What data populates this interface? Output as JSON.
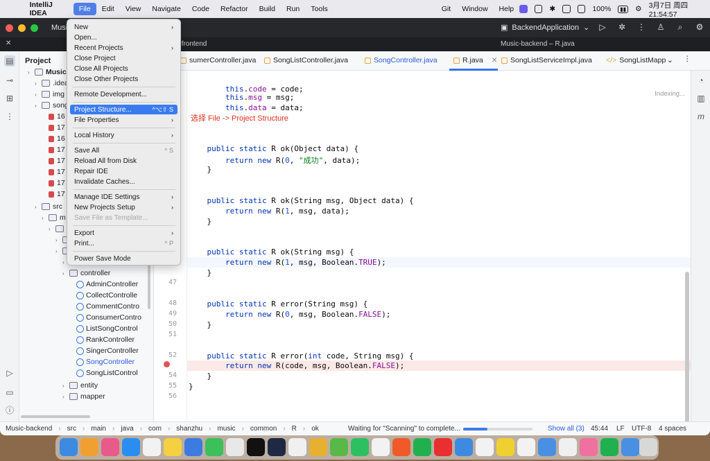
{
  "menubar": {
    "app_name": "IntelliJ IDEA",
    "items": [
      "File",
      "Edit",
      "View",
      "Navigate",
      "Code",
      "Refactor",
      "Build",
      "Run",
      "Tools"
    ],
    "right_items": [
      "Git",
      "Window",
      "Help"
    ],
    "battery": "100%",
    "datetime": "3月7日 周四  21:54:57"
  },
  "titlebar": {
    "project": "Music-b",
    "run_config": "BackendApplication",
    "frontend_tab": "r-frontend",
    "backend_title": "Music-backend – R.java"
  },
  "project_panel": {
    "header": "Project",
    "rows": [
      {
        "label": "Music-",
        "kind": "module"
      },
      {
        "label": ".idea",
        "kind": "folder"
      },
      {
        "label": "img",
        "kind": "folder"
      },
      {
        "label": "song",
        "kind": "folder"
      },
      {
        "label": "16",
        "kind": "res"
      },
      {
        "label": "17",
        "kind": "res"
      },
      {
        "label": "16",
        "kind": "res"
      },
      {
        "label": "17",
        "kind": "res"
      },
      {
        "label": "17",
        "kind": "res"
      },
      {
        "label": "17",
        "kind": "res"
      },
      {
        "label": "17",
        "kind": "res"
      },
      {
        "label": "17",
        "kind": "res"
      },
      {
        "label": "src",
        "kind": "folder"
      },
      {
        "label": "m",
        "kind": "folder"
      },
      {
        "label": "",
        "kind": "pkg"
      },
      {
        "label": "",
        "kind": "pkg"
      },
      {
        "label": "",
        "kind": "pkg"
      },
      {
        "label": "config",
        "kind": "folder"
      },
      {
        "label": "controller",
        "kind": "folder"
      },
      {
        "label": "AdminController",
        "kind": "class"
      },
      {
        "label": "CollectControlle",
        "kind": "class"
      },
      {
        "label": "CommentContro",
        "kind": "class"
      },
      {
        "label": "ConsumerContro",
        "kind": "class"
      },
      {
        "label": "ListSongControl",
        "kind": "class"
      },
      {
        "label": "RankController",
        "kind": "class"
      },
      {
        "label": "SingerController",
        "kind": "class"
      },
      {
        "label": "SongController",
        "kind": "class-active"
      },
      {
        "label": "SongListControl",
        "kind": "class"
      },
      {
        "label": "entity",
        "kind": "folder"
      },
      {
        "label": "mapper",
        "kind": "folder"
      }
    ]
  },
  "editor_tabs": [
    {
      "label": "sumerController.java"
    },
    {
      "label": "SongListController.java"
    },
    {
      "label": "SongController.java"
    },
    {
      "label": "R.java",
      "selected": true
    },
    {
      "label": "SongListServiceImpl.java"
    },
    {
      "label": "SongListMapp"
    }
  ],
  "editor": {
    "annotation": "选择 File -> Project Structure",
    "indexing": "Indexing...",
    "line_numbers": [
      "47",
      "48",
      "49",
      "50",
      "51",
      "52",
      "53",
      "54",
      "55",
      "56"
    ]
  },
  "file_menu": {
    "items": [
      {
        "label": "New",
        "submenu": true
      },
      {
        "label": "Open..."
      },
      {
        "label": "Recent Projects",
        "submenu": true
      },
      {
        "label": "Close Project"
      },
      {
        "label": "Close All Projects"
      },
      {
        "label": "Close Other Projects"
      },
      {
        "sep": true
      },
      {
        "label": "Remote Development..."
      },
      {
        "sep": true
      },
      {
        "label": "Project Structure...",
        "shortcut": "^⌥⇧ S",
        "highlighted": true
      },
      {
        "label": "File Properties",
        "submenu": true
      },
      {
        "sep": true
      },
      {
        "label": "Local History",
        "submenu": true
      },
      {
        "sep": true
      },
      {
        "label": "Save All",
        "shortcut": "^ S"
      },
      {
        "label": "Reload All from Disk"
      },
      {
        "label": "Repair IDE"
      },
      {
        "label": "Invalidate Caches..."
      },
      {
        "sep": true
      },
      {
        "label": "Manage IDE Settings",
        "submenu": true
      },
      {
        "label": "New Projects Setup",
        "submenu": true
      },
      {
        "label": "Save File as Template...",
        "disabled": true
      },
      {
        "sep": true
      },
      {
        "label": "Export",
        "submenu": true
      },
      {
        "label": "Print...",
        "shortcut": "^ P"
      },
      {
        "sep": true
      },
      {
        "label": "Power Save Mode"
      }
    ]
  },
  "statusbar": {
    "crumbs": [
      "Music-backend",
      "src",
      "main",
      "java",
      "com",
      "shanzhu",
      "music",
      "common",
      "R",
      "ok"
    ],
    "progress_text": "Waiting for \"Scanning\" to complete...",
    "progress_fraction": 0.35,
    "show_all": "Show all (3)",
    "position": "45:44",
    "line_sep": "LF",
    "encoding": "UTF-8",
    "indent": "4 spaces"
  },
  "colors": {
    "accent": "#3a7cf0",
    "titlebar": "#27282c",
    "annotation": "#e0301e"
  }
}
